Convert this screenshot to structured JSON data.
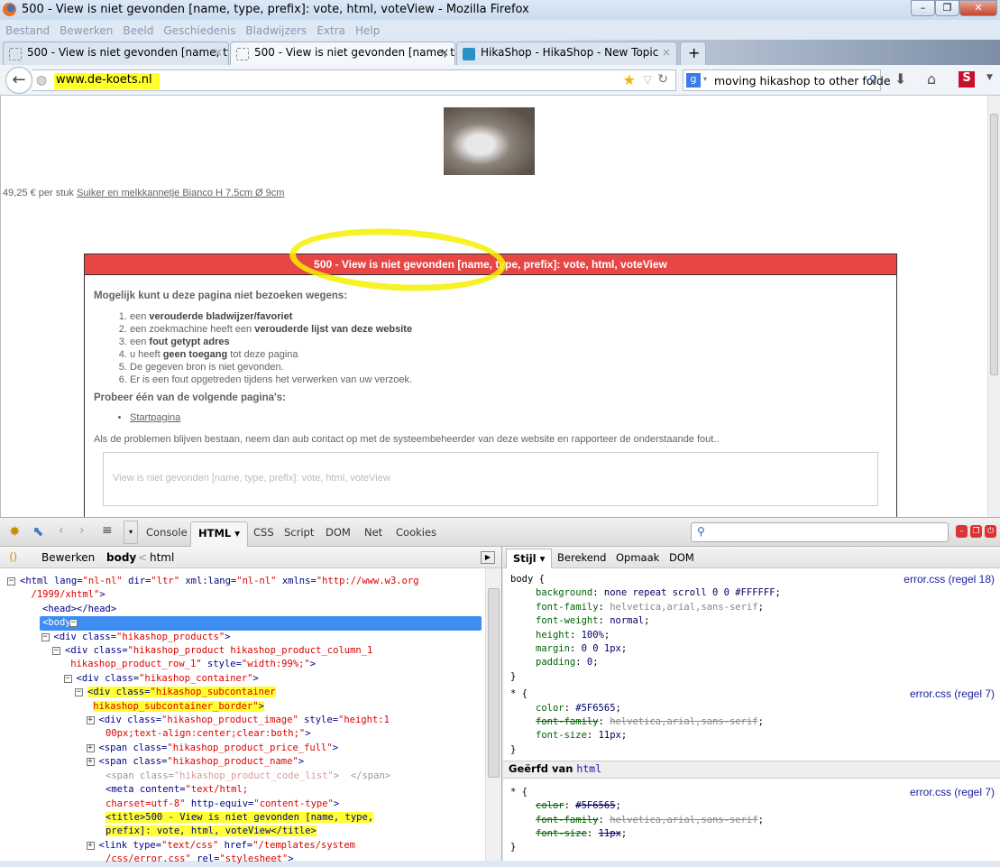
{
  "window": {
    "title": "500 - View is niet gevonden [name, type, prefix]: vote, html, voteView - Mozilla Firefox",
    "btns": [
      "–",
      "❐",
      "✕"
    ]
  },
  "menu": [
    "Bestand",
    "Bewerken",
    "Beeld",
    "Geschiedenis",
    "Bladwijzers",
    "Extra",
    "Help"
  ],
  "tabs": [
    {
      "label": "500 - View is niet gevonden [name, ty...",
      "close": "×"
    },
    {
      "label": "500 - View is niet gevonden [name, ty...",
      "close": "×"
    },
    {
      "label": "HikaShop - HikaShop - New Topic",
      "close": "×"
    }
  ],
  "new_tab": "+",
  "nav": {
    "url": "www.de-koets.nl",
    "search": "moving hikashop to other folde",
    "addon": "S"
  },
  "page": {
    "price": "49,25 € per stuk",
    "product": "Suiker en melkkannetje Bianco H 7.5cm Ø 9cm",
    "error_title": "500 - View is niet gevonden [name, type, prefix]: vote, html, voteView",
    "h_reasons": "Mogelijk kunt u deze pagina niet bezoeken wegens:",
    "reasons": [
      [
        "een ",
        "verouderde bladwijzer/favoriet",
        ""
      ],
      [
        "een zoekmachine heeft een ",
        "verouderde lijst van deze website",
        ""
      ],
      [
        "een ",
        "fout getypt adres",
        ""
      ],
      [
        "u heeft ",
        "geen toegang",
        " tot deze pagina"
      ],
      [
        "De gegeven bron is niet gevonden.",
        "",
        ""
      ],
      [
        "Er is een fout opgetreden tijdens het verwerken van uw verzoek.",
        "",
        ""
      ]
    ],
    "h_try": "Probeer één van de volgende pagina's:",
    "link": "Startpagina",
    "contact": "Als de problemen blijven bestaan, neem dan aub contact op met de systeembeheerder van deze website en rapporteer de onderstaande fout..",
    "message": "View is niet gevonden [name, type, prefix]: vote, html, voteView"
  },
  "firebug": {
    "tabs": [
      "Console",
      "HTML ▾",
      "CSS",
      "Script",
      "DOM",
      "Net",
      "Cookies"
    ],
    "edit": "Bewerken",
    "crumb_current": "body",
    "crumb_sep": "<",
    "crumb_parent": "html",
    "side_tabs": [
      "Stijl ▾",
      "Berekend",
      "Opmaak",
      "DOM"
    ],
    "dom": [
      {
        "i": 0,
        "tog": "−",
        "p": [
          [
            "tg",
            "<html "
          ],
          [
            "at",
            "lang="
          ],
          [
            "vl",
            "\"nl-nl\""
          ],
          [
            "at",
            " dir="
          ],
          [
            "vl",
            "\"ltr\""
          ],
          [
            "at",
            " xml:lang="
          ],
          [
            "vl",
            "\"nl-nl\""
          ],
          [
            "at",
            " xmlns="
          ],
          [
            "vl",
            "\"http://www.w3.org"
          ]
        ]
      },
      {
        "i": 1,
        "p": [
          [
            "vl",
            "/1999/xhtml\""
          ],
          [
            "tg",
            ">"
          ]
        ]
      },
      {
        "i": 2,
        "p": [
          [
            "tg",
            "<head></head>"
          ]
        ]
      },
      {
        "i": 2,
        "tog": "−",
        "sel": true,
        "p": [
          [
            "tg",
            "<body>"
          ]
        ]
      },
      {
        "i": 3,
        "tog": "−",
        "p": [
          [
            "tg",
            "<div "
          ],
          [
            "at",
            "class="
          ],
          [
            "vl",
            "\"hikashop_products\""
          ],
          [
            "tg",
            ">"
          ]
        ]
      },
      {
        "i": 4,
        "tog": "−",
        "p": [
          [
            "tg",
            "<div "
          ],
          [
            "at",
            "class="
          ],
          [
            "vl",
            "\"hikashop_product hikashop_product_column_1"
          ]
        ]
      },
      {
        "i": 4.5,
        "p": [
          [
            "vl",
            "hikashop_product_row_1\""
          ],
          [
            "at",
            " style="
          ],
          [
            "vl",
            "\"width:99%;\""
          ],
          [
            "tg",
            ">"
          ]
        ]
      },
      {
        "i": 5,
        "tog": "−",
        "p": [
          [
            "tg",
            "<div "
          ],
          [
            "at",
            "class="
          ],
          [
            "vl",
            "\"hikashop_container\""
          ],
          [
            "tg",
            ">"
          ]
        ]
      },
      {
        "i": 6,
        "tog": "−",
        "hl": true,
        "p": [
          [
            "tg",
            "<div "
          ],
          [
            "at",
            "class="
          ],
          [
            "vl",
            "\"hikashop_subcontainer"
          ]
        ]
      },
      {
        "i": 6.5,
        "hl": true,
        "p": [
          [
            "vl",
            "hikashop_subcontainer_border\""
          ],
          [
            "tg",
            ">"
          ]
        ]
      },
      {
        "i": 7,
        "tog": "+",
        "p": [
          [
            "tg",
            "<div "
          ],
          [
            "at",
            "class="
          ],
          [
            "vl",
            "\"hikashop_product_image\""
          ],
          [
            "at",
            " style="
          ],
          [
            "vl",
            "\"height:1"
          ]
        ]
      },
      {
        "i": 7.6,
        "p": [
          [
            "vl",
            "00px;text-align:center;clear:both;\""
          ],
          [
            "tg",
            ">"
          ]
        ]
      },
      {
        "i": 7,
        "tog": "+",
        "p": [
          [
            "tg",
            "<span "
          ],
          [
            "at",
            "class="
          ],
          [
            "vl",
            "\"hikashop_product_price_full\""
          ],
          [
            "tg",
            ">"
          ]
        ]
      },
      {
        "i": 7,
        "tog": "+",
        "p": [
          [
            "tg",
            "<span "
          ],
          [
            "at",
            "class="
          ],
          [
            "vl",
            "\"hikashop_product_name\""
          ],
          [
            "tg",
            ">"
          ]
        ]
      },
      {
        "i": 7.6,
        "p": [
          [
            "gr",
            "<span class="
          ],
          [
            "gv",
            "\"hikashop_product_code_list\""
          ],
          [
            "gr",
            ">  </span>"
          ]
        ]
      },
      {
        "i": 7.6,
        "p": [
          [
            "tg",
            "<meta "
          ],
          [
            "at",
            "content="
          ],
          [
            "vl",
            "\"text/html;"
          ]
        ]
      },
      {
        "i": 7.6,
        "p": [
          [
            "vl",
            "charset=utf-8\""
          ],
          [
            "at",
            " http-equiv="
          ],
          [
            "vl",
            "\"content-type\""
          ],
          [
            "tg",
            ">"
          ]
        ]
      },
      {
        "i": 7.6,
        "hl": true,
        "p": [
          [
            "tg",
            "<title>"
          ],
          [
            "at",
            "500 - View is niet gevonden [name, type,"
          ]
        ]
      },
      {
        "i": 7.6,
        "hl": true,
        "p": [
          [
            "at",
            "prefix]: vote, html, voteView"
          ],
          [
            "tg",
            "</title>"
          ]
        ]
      },
      {
        "i": 7,
        "tog": "+",
        "p": [
          [
            "tg",
            "<link "
          ],
          [
            "at",
            "type="
          ],
          [
            "vl",
            "\"text/css\""
          ],
          [
            "at",
            " href="
          ],
          [
            "vl",
            "\"/templates/system"
          ]
        ]
      },
      {
        "i": 7.6,
        "p": [
          [
            "vl",
            "/css/error.css\""
          ],
          [
            "at",
            " rel="
          ],
          [
            "vl",
            "\"stylesheet\""
          ],
          [
            "tg",
            ">"
          ]
        ]
      }
    ],
    "rules": [
      {
        "sel": "body {",
        "src": "error.css (regel 18)",
        "props": [
          [
            "background",
            "none repeat scroll 0 0 #FFFFFF",
            false,
            false
          ],
          [
            "font-family",
            "helvetica,arial,sans-serif",
            false,
            true
          ],
          [
            "font-weight",
            "normal",
            false,
            false
          ],
          [
            "height",
            "100%",
            false,
            false
          ],
          [
            "margin",
            "0 0 1px",
            false,
            false
          ],
          [
            "padding",
            "0",
            false,
            false
          ]
        ]
      },
      {
        "sel": "* {",
        "src": "error.css (regel 7)",
        "props": [
          [
            "color",
            "#5F6565",
            false,
            false
          ],
          [
            "font-family",
            "helvetica,arial,sans-serif",
            true,
            true
          ],
          [
            "font-size",
            "11px",
            false,
            false
          ]
        ]
      },
      {
        "inherit_label": "Geërfd van",
        "inherit_from": "html",
        "sel": "* {",
        "src": "error.css (regel 7)",
        "props": [
          [
            "color",
            "#5F6565",
            true,
            false
          ],
          [
            "font-family",
            "helvetica,arial,sans-serif",
            true,
            true
          ],
          [
            "font-size",
            "11px",
            true,
            false
          ]
        ]
      }
    ],
    "close_brace": "}"
  }
}
